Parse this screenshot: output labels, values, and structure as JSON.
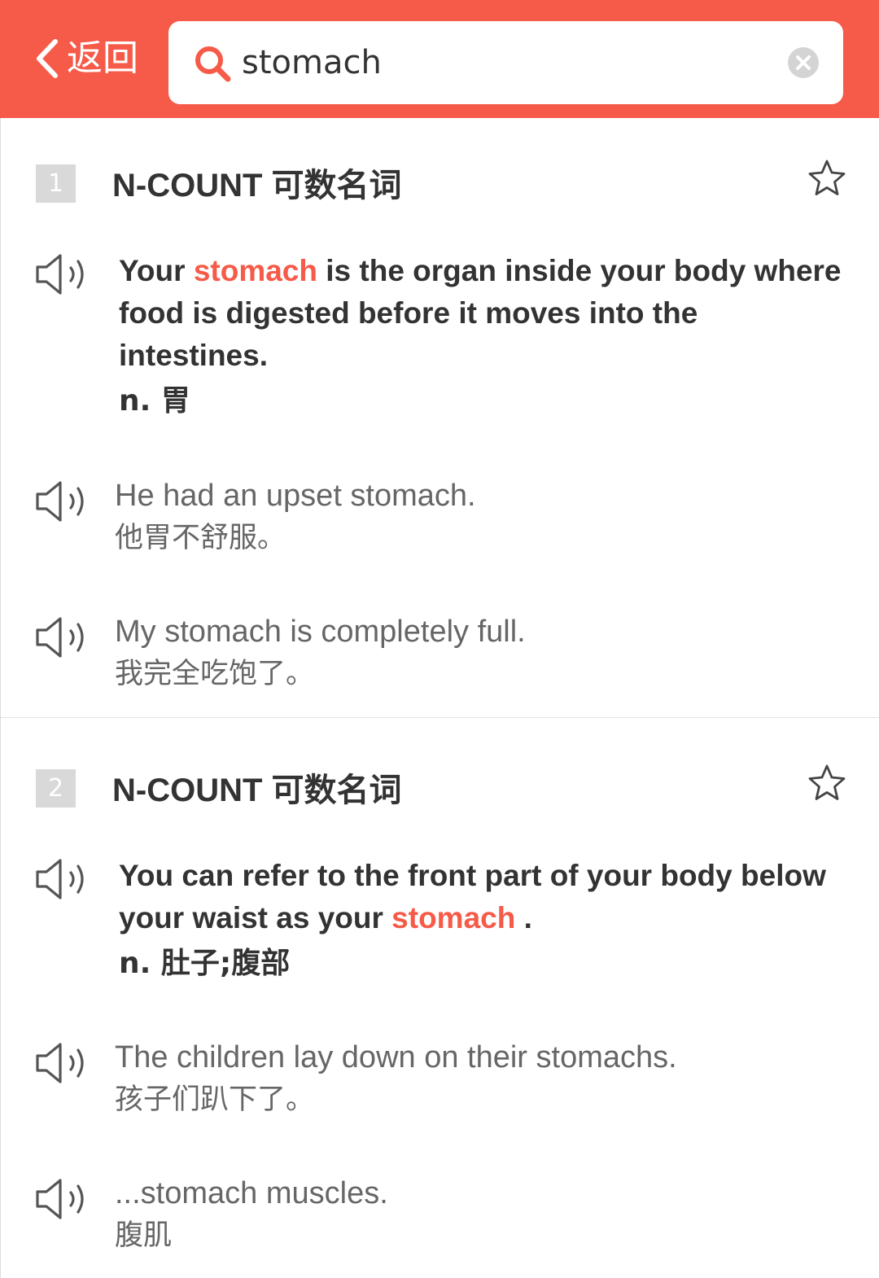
{
  "header": {
    "back_label": "返回",
    "search_value": "stomach",
    "accent_color": "#f65a48"
  },
  "senses": [
    {
      "number": "1",
      "pos": "N-COUNT 可数名词",
      "definition": {
        "before": "Your ",
        "headword": "stomach",
        "after": " is the organ inside your body where food is digested before it moves into the intestines.",
        "chinese": "n. 胃"
      },
      "examples": [
        {
          "en": "He had an upset stomach.",
          "cn": "他胃不舒服。"
        },
        {
          "en": "My stomach is completely full.",
          "cn": "我完全吃饱了。"
        }
      ]
    },
    {
      "number": "2",
      "pos": "N-COUNT 可数名词",
      "definition": {
        "before": "You can refer to the front part of your body below your waist as your ",
        "headword": "stomach",
        "after": " .",
        "chinese": "n. 肚子;腹部"
      },
      "examples": [
        {
          "en": "The children lay down on their stomachs.",
          "cn": "孩子们趴下了。"
        },
        {
          "en": "...stomach muscles.",
          "cn": "腹肌"
        }
      ]
    }
  ],
  "icons": {
    "back": "chevron-left-icon",
    "search": "search-icon",
    "clear": "clear-icon",
    "favorite": "star-outline-icon",
    "audio": "speaker-icon"
  }
}
